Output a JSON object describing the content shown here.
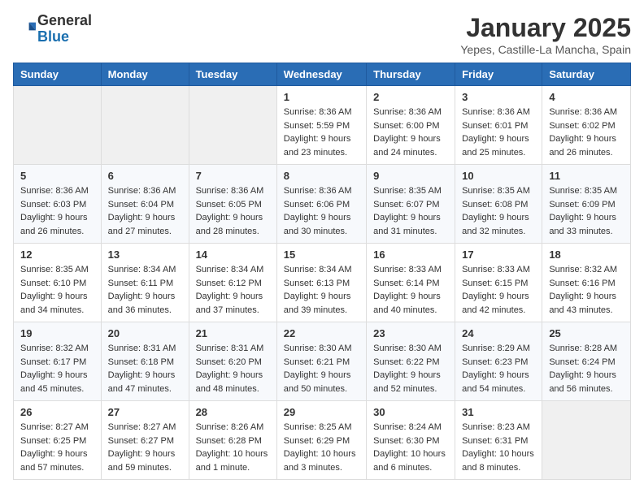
{
  "header": {
    "logo_general": "General",
    "logo_blue": "Blue",
    "month": "January 2025",
    "location": "Yepes, Castille-La Mancha, Spain"
  },
  "days_of_week": [
    "Sunday",
    "Monday",
    "Tuesday",
    "Wednesday",
    "Thursday",
    "Friday",
    "Saturday"
  ],
  "weeks": [
    [
      {
        "day": "",
        "info": ""
      },
      {
        "day": "",
        "info": ""
      },
      {
        "day": "",
        "info": ""
      },
      {
        "day": "1",
        "info": "Sunrise: 8:36 AM\nSunset: 5:59 PM\nDaylight: 9 hours\nand 23 minutes."
      },
      {
        "day": "2",
        "info": "Sunrise: 8:36 AM\nSunset: 6:00 PM\nDaylight: 9 hours\nand 24 minutes."
      },
      {
        "day": "3",
        "info": "Sunrise: 8:36 AM\nSunset: 6:01 PM\nDaylight: 9 hours\nand 25 minutes."
      },
      {
        "day": "4",
        "info": "Sunrise: 8:36 AM\nSunset: 6:02 PM\nDaylight: 9 hours\nand 26 minutes."
      }
    ],
    [
      {
        "day": "5",
        "info": "Sunrise: 8:36 AM\nSunset: 6:03 PM\nDaylight: 9 hours\nand 26 minutes."
      },
      {
        "day": "6",
        "info": "Sunrise: 8:36 AM\nSunset: 6:04 PM\nDaylight: 9 hours\nand 27 minutes."
      },
      {
        "day": "7",
        "info": "Sunrise: 8:36 AM\nSunset: 6:05 PM\nDaylight: 9 hours\nand 28 minutes."
      },
      {
        "day": "8",
        "info": "Sunrise: 8:36 AM\nSunset: 6:06 PM\nDaylight: 9 hours\nand 30 minutes."
      },
      {
        "day": "9",
        "info": "Sunrise: 8:35 AM\nSunset: 6:07 PM\nDaylight: 9 hours\nand 31 minutes."
      },
      {
        "day": "10",
        "info": "Sunrise: 8:35 AM\nSunset: 6:08 PM\nDaylight: 9 hours\nand 32 minutes."
      },
      {
        "day": "11",
        "info": "Sunrise: 8:35 AM\nSunset: 6:09 PM\nDaylight: 9 hours\nand 33 minutes."
      }
    ],
    [
      {
        "day": "12",
        "info": "Sunrise: 8:35 AM\nSunset: 6:10 PM\nDaylight: 9 hours\nand 34 minutes."
      },
      {
        "day": "13",
        "info": "Sunrise: 8:34 AM\nSunset: 6:11 PM\nDaylight: 9 hours\nand 36 minutes."
      },
      {
        "day": "14",
        "info": "Sunrise: 8:34 AM\nSunset: 6:12 PM\nDaylight: 9 hours\nand 37 minutes."
      },
      {
        "day": "15",
        "info": "Sunrise: 8:34 AM\nSunset: 6:13 PM\nDaylight: 9 hours\nand 39 minutes."
      },
      {
        "day": "16",
        "info": "Sunrise: 8:33 AM\nSunset: 6:14 PM\nDaylight: 9 hours\nand 40 minutes."
      },
      {
        "day": "17",
        "info": "Sunrise: 8:33 AM\nSunset: 6:15 PM\nDaylight: 9 hours\nand 42 minutes."
      },
      {
        "day": "18",
        "info": "Sunrise: 8:32 AM\nSunset: 6:16 PM\nDaylight: 9 hours\nand 43 minutes."
      }
    ],
    [
      {
        "day": "19",
        "info": "Sunrise: 8:32 AM\nSunset: 6:17 PM\nDaylight: 9 hours\nand 45 minutes."
      },
      {
        "day": "20",
        "info": "Sunrise: 8:31 AM\nSunset: 6:18 PM\nDaylight: 9 hours\nand 47 minutes."
      },
      {
        "day": "21",
        "info": "Sunrise: 8:31 AM\nSunset: 6:20 PM\nDaylight: 9 hours\nand 48 minutes."
      },
      {
        "day": "22",
        "info": "Sunrise: 8:30 AM\nSunset: 6:21 PM\nDaylight: 9 hours\nand 50 minutes."
      },
      {
        "day": "23",
        "info": "Sunrise: 8:30 AM\nSunset: 6:22 PM\nDaylight: 9 hours\nand 52 minutes."
      },
      {
        "day": "24",
        "info": "Sunrise: 8:29 AM\nSunset: 6:23 PM\nDaylight: 9 hours\nand 54 minutes."
      },
      {
        "day": "25",
        "info": "Sunrise: 8:28 AM\nSunset: 6:24 PM\nDaylight: 9 hours\nand 56 minutes."
      }
    ],
    [
      {
        "day": "26",
        "info": "Sunrise: 8:27 AM\nSunset: 6:25 PM\nDaylight: 9 hours\nand 57 minutes."
      },
      {
        "day": "27",
        "info": "Sunrise: 8:27 AM\nSunset: 6:27 PM\nDaylight: 9 hours\nand 59 minutes."
      },
      {
        "day": "28",
        "info": "Sunrise: 8:26 AM\nSunset: 6:28 PM\nDaylight: 10 hours\nand 1 minute."
      },
      {
        "day": "29",
        "info": "Sunrise: 8:25 AM\nSunset: 6:29 PM\nDaylight: 10 hours\nand 3 minutes."
      },
      {
        "day": "30",
        "info": "Sunrise: 8:24 AM\nSunset: 6:30 PM\nDaylight: 10 hours\nand 6 minutes."
      },
      {
        "day": "31",
        "info": "Sunrise: 8:23 AM\nSunset: 6:31 PM\nDaylight: 10 hours\nand 8 minutes."
      },
      {
        "day": "",
        "info": ""
      }
    ]
  ]
}
